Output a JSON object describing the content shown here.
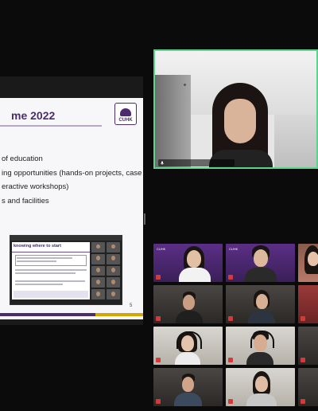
{
  "slide": {
    "title": "me 2022",
    "logo_text": "CUHK",
    "bullets": [
      "of education",
      "ing opportunities (hands-on projects, case",
      "eractive workshops)",
      "s and facilities"
    ],
    "embedded_heading": "knowing where to start",
    "page_number": "5"
  },
  "speaker": {
    "name": "Participant",
    "border_color": "#5fd38c"
  },
  "gallery": {
    "tiles": [
      {
        "bg": "purple",
        "brand": "CUHK"
      },
      {
        "bg": "purple",
        "brand": "CUHK"
      },
      {
        "bg": "pink"
      },
      {
        "bg": "office"
      },
      {
        "bg": "office"
      },
      {
        "bg": "red"
      },
      {
        "bg": "light"
      },
      {
        "bg": "light"
      },
      {
        "bg": "office"
      },
      {
        "bg": "office"
      },
      {
        "bg": "light"
      },
      {
        "bg": "office"
      }
    ]
  },
  "colors": {
    "brand_purple": "#4b2c6e",
    "brand_gold": "#d4a600",
    "active_speaker": "#5fd38c",
    "muted_mic": "#d23b3b"
  }
}
